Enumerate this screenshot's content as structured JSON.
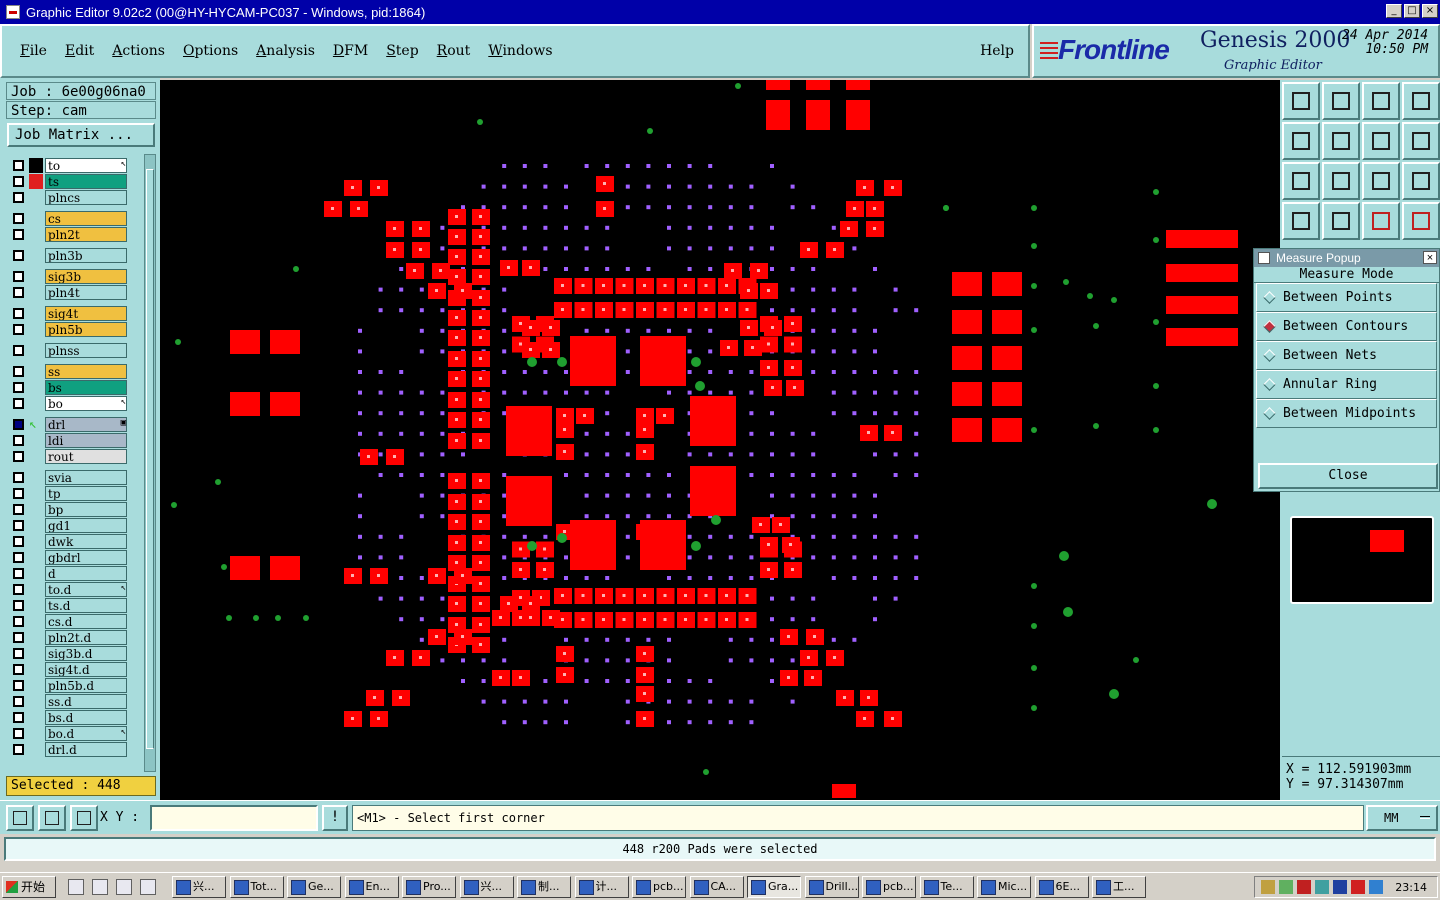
{
  "window": {
    "title": "Graphic Editor 9.02c2 (00@HY-HYCAM-PC037 - Windows, pid:1864)"
  },
  "menu": {
    "items": [
      "File",
      "Edit",
      "Actions",
      "Options",
      "Analysis",
      "DFM",
      "Step",
      "Rout",
      "Windows"
    ],
    "help": "Help"
  },
  "brand": {
    "logo": "Frontline",
    "product": "Genesis 2000",
    "subtitle": "Graphic Editor",
    "date": "24 Apr 2014",
    "time": "10:50 PM"
  },
  "job": {
    "job_line": "Job : 6e00g06na0",
    "step_line": "Step: cam",
    "matrix_button": "Job Matrix ..."
  },
  "layers": [
    {
      "name": "to",
      "color": "#ffffff",
      "mark": "white",
      "sub": "↖"
    },
    {
      "name": "ts",
      "color": "#10a080",
      "mark": "red"
    },
    {
      "name": "plncs",
      "color": "#a8dcdc"
    },
    {
      "name": "cs",
      "color": "#f0c040"
    },
    {
      "name": "pln2t",
      "color": "#f0c040"
    },
    {
      "name": "pln3b",
      "color": "#a8dcdc"
    },
    {
      "name": "sig3b",
      "color": "#f0c040"
    },
    {
      "name": "pln4t",
      "color": "#a8dcdc"
    },
    {
      "name": "sig4t",
      "color": "#f0c040"
    },
    {
      "name": "pln5b",
      "color": "#f0c040"
    },
    {
      "name": "plnss",
      "color": "#a8dcdc"
    },
    {
      "name": "ss",
      "color": "#f0c040"
    },
    {
      "name": "bs",
      "color": "#10a080"
    },
    {
      "name": "bo",
      "color": "#ffffff",
      "sub": "↖"
    },
    {
      "name": "drl",
      "color": "#a8b8c8",
      "mark": "arrow",
      "sub": "▣"
    },
    {
      "name": "ldi",
      "color": "#a8b8c8"
    },
    {
      "name": "rout",
      "color": "#e0e0e0"
    },
    {
      "name": "svia",
      "color": "#a8dcdc"
    },
    {
      "name": "tp",
      "color": "#a8dcdc"
    },
    {
      "name": "bp",
      "color": "#a8dcdc"
    },
    {
      "name": "gd1",
      "color": "#a8dcdc"
    },
    {
      "name": "dwk",
      "color": "#a8dcdc"
    },
    {
      "name": "gbdrl",
      "color": "#a8dcdc"
    },
    {
      "name": "d",
      "color": "#a8dcdc"
    },
    {
      "name": "to.d",
      "color": "#a8dcdc",
      "sub": "↖"
    },
    {
      "name": "ts.d",
      "color": "#a8dcdc"
    },
    {
      "name": "cs.d",
      "color": "#a8dcdc"
    },
    {
      "name": "pln2t.d",
      "color": "#a8dcdc"
    },
    {
      "name": "sig3b.d",
      "color": "#a8dcdc"
    },
    {
      "name": "sig4t.d",
      "color": "#a8dcdc"
    },
    {
      "name": "pln5b.d",
      "color": "#a8dcdc"
    },
    {
      "name": "ss.d",
      "color": "#a8dcdc"
    },
    {
      "name": "bs.d",
      "color": "#a8dcdc"
    },
    {
      "name": "bo.d",
      "color": "#a8dcdc",
      "sub": "↖"
    },
    {
      "name": "drl.d",
      "color": "#a8dcdc"
    }
  ],
  "selected": "Selected : 448",
  "measure": {
    "title": "Measure Popup",
    "mode_label": "Measure Mode",
    "options": [
      "Between Points",
      "Between Contours",
      "Between Nets",
      "Annular Ring",
      "Between Midpoints"
    ],
    "active_option": 1,
    "close": "Close"
  },
  "coords": {
    "x": "X = 112.591903mm",
    "y": "Y = 97.314307mm"
  },
  "bottom": {
    "xy_label": "X Y :",
    "xy_value": "",
    "hint": "<M1> - Select first corner",
    "unit": "MM"
  },
  "status": "448 r200 Pads were selected",
  "taskbar": {
    "start": "开始",
    "tasks": [
      "兴...",
      "Tot...",
      "Ge...",
      "En...",
      "Pro...",
      "兴...",
      "制...",
      "计...",
      "pcb...",
      "CA...",
      "Gra...",
      "Drill...",
      "pcb...",
      "Te...",
      "Mic...",
      "6E...",
      "工..."
    ],
    "active_task": 10,
    "clock": "23:14"
  },
  "colors": {
    "pad": "#ff0000",
    "via": "#a060ff",
    "fiducial": "#20a030",
    "panel": "#a8dcdc"
  }
}
